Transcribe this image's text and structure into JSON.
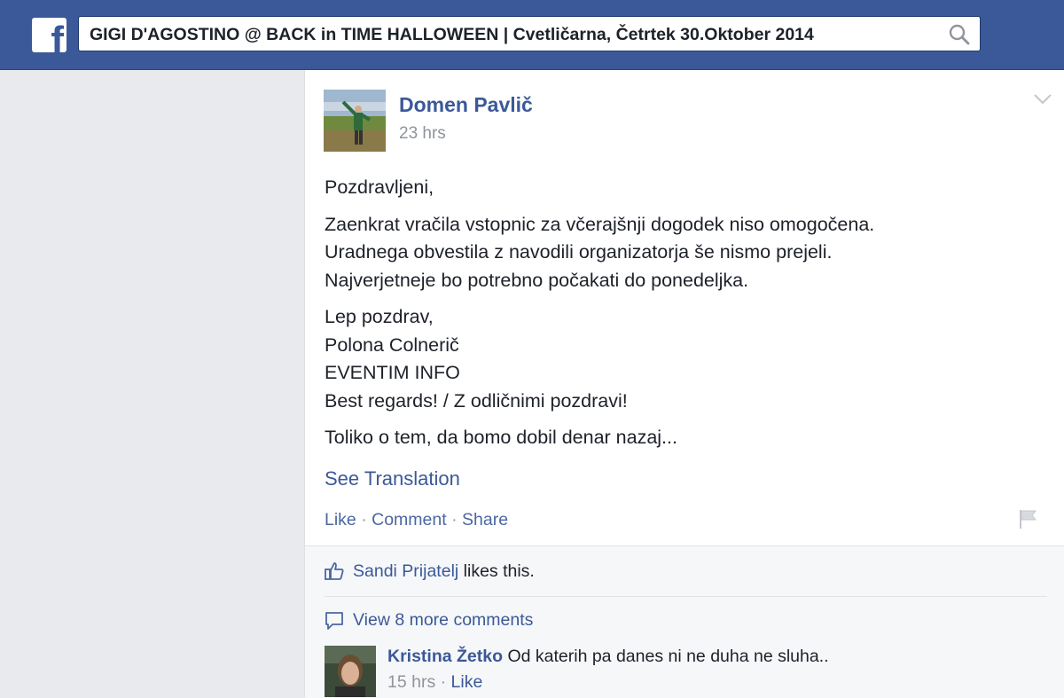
{
  "topbar": {
    "logo": "f",
    "search_value": "GIGI D'AGOSTINO @ BACK in TIME HALLOWEEN | Cvetličarna, Četrtek 30.Oktober 2014"
  },
  "post": {
    "author": "Domen Pavlič",
    "time": "23 hrs",
    "paragraphs": [
      "Pozdravljeni,",
      "Zaenkrat vračila vstopnic za včerajšnji dogodek niso omogočena.",
      "Uradnega obvestila z navodili organizatorja še nismo prejeli.",
      "Najverjetneje bo potrebno počakati do ponedeljka.",
      "Lep pozdrav,",
      "Polona Colnerič",
      "EVENTIM INFO",
      "Best regards! / Z odličnimi pozdravi!",
      "Toliko o tem, da bomo dobil denar nazaj..."
    ],
    "see_translation": "See Translation",
    "actions": {
      "like": "Like",
      "comment": "Comment",
      "share": "Share",
      "separator": "·"
    }
  },
  "ufi": {
    "liker": "Sandi Prijatelj",
    "likes_suffix": "likes this.",
    "view_more": "View 8 more comments",
    "comment": {
      "author": "Kristina Žetko",
      "text": "Od katerih pa danes ni ne duha ne sluha..",
      "time": "15 hrs",
      "like": "Like"
    }
  },
  "colors": {
    "brand": "#3b5998",
    "background": "#e9eaed",
    "muted": "#90949c"
  }
}
